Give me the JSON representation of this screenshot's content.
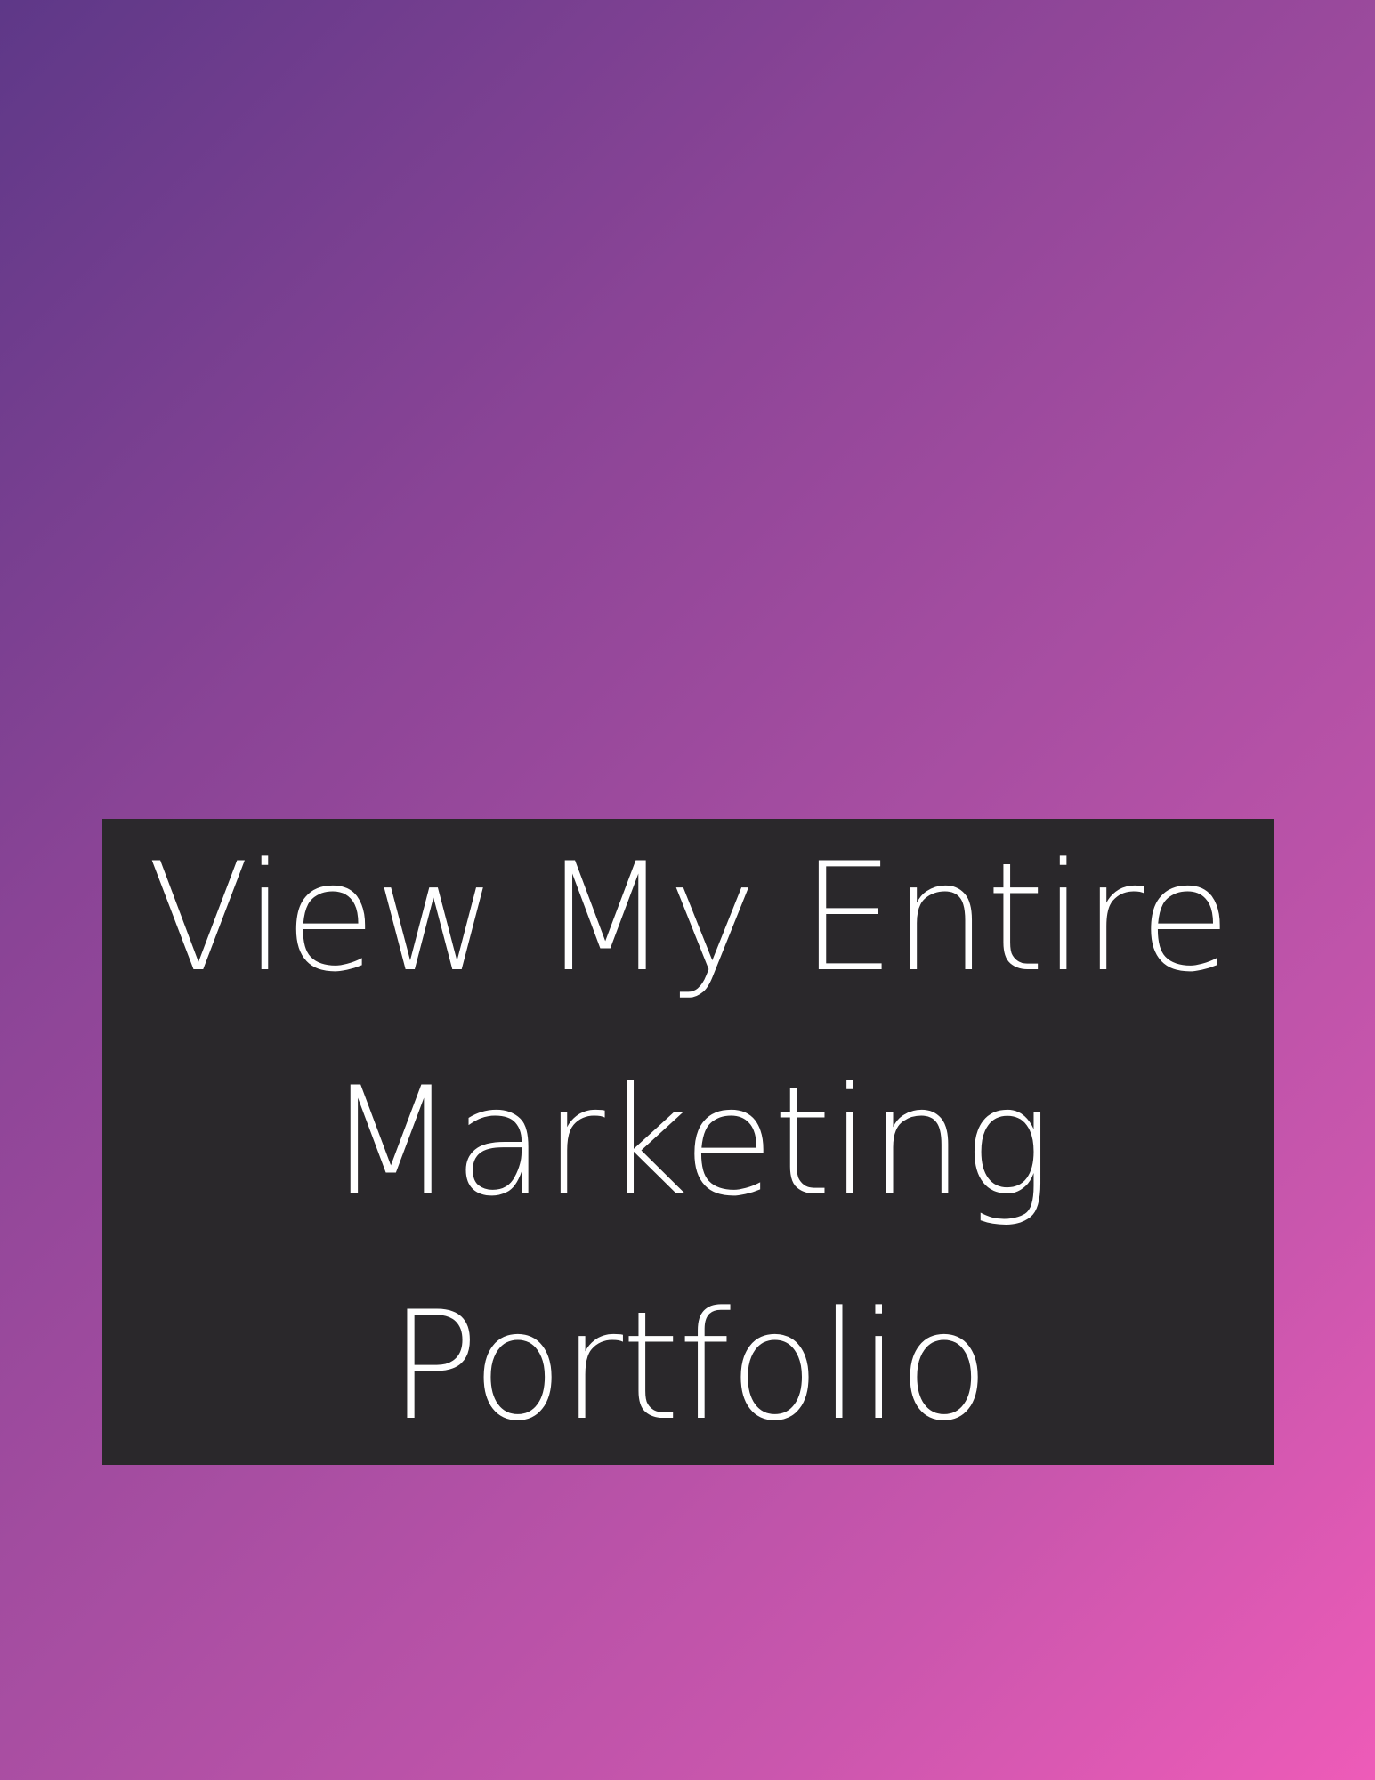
{
  "page": {
    "background_colors": [
      "#5e3888",
      "#a84ea2",
      "#ee5bb8"
    ]
  },
  "cta": {
    "label": "View My Entire Marketing Portfolio",
    "box_color": "#2a282b",
    "text_color": "#ffffff"
  }
}
